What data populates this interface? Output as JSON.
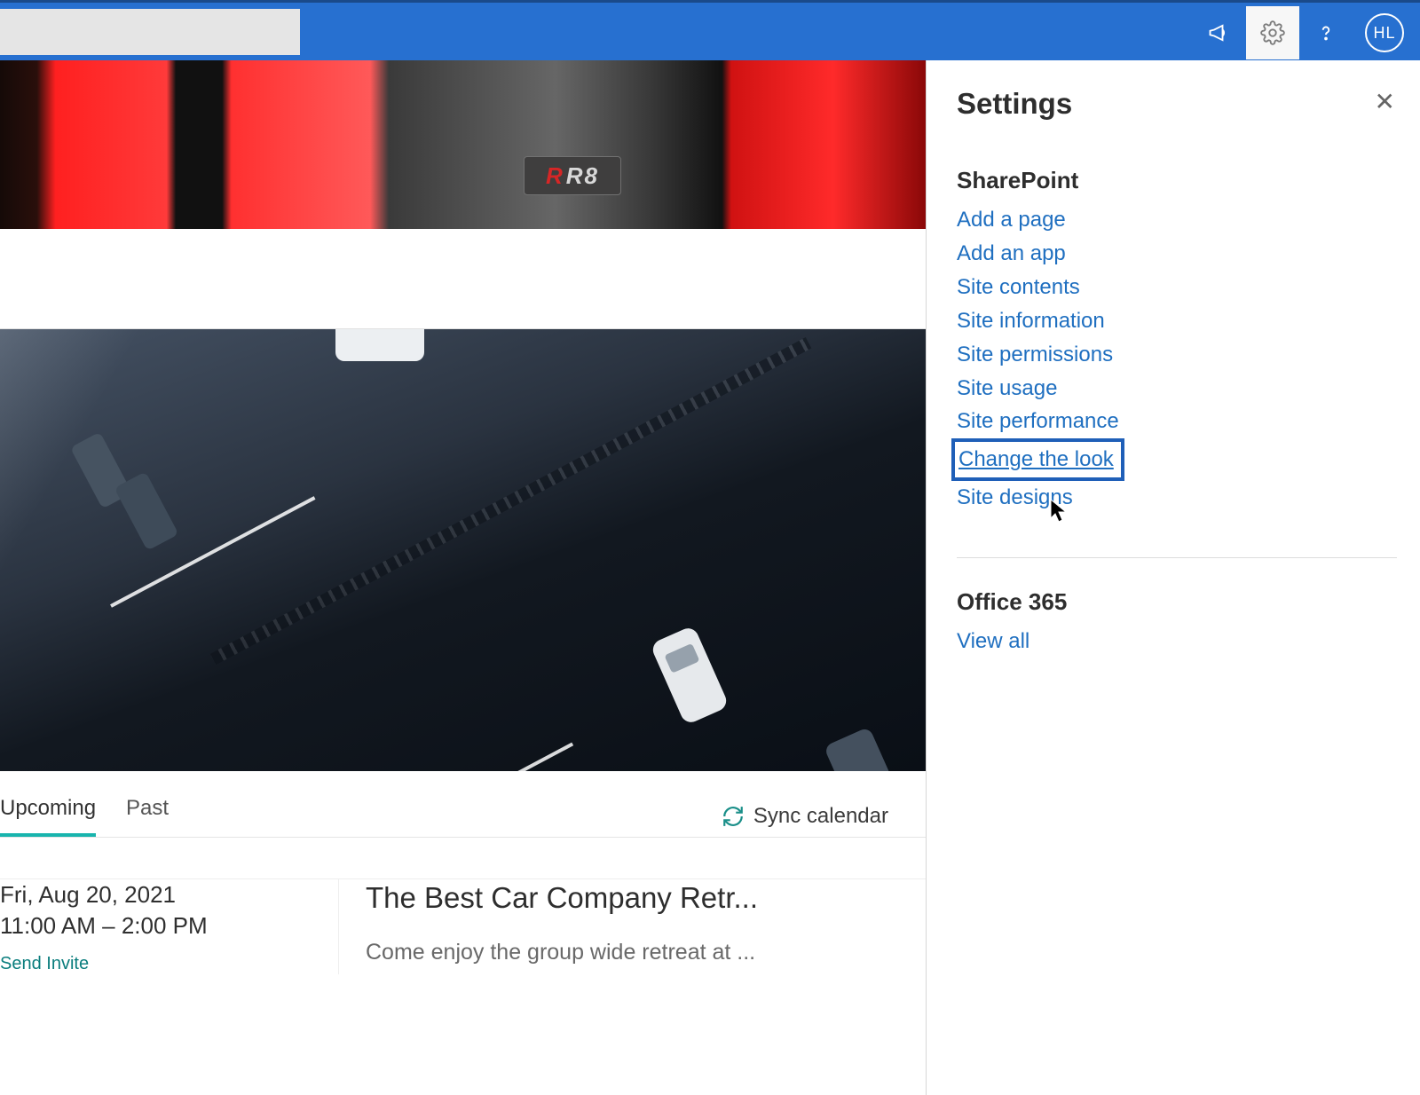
{
  "header": {
    "search_value": "",
    "avatar_initials": "HL"
  },
  "hero": {
    "badge_main": "R8"
  },
  "events": {
    "tab_upcoming": "Upcoming",
    "tab_past": "Past",
    "sync_label": "Sync calendar",
    "item1": {
      "date": "Fri, Aug 20, 2021",
      "time": "11:00 AM – 2:00 PM",
      "invite": "Send Invite",
      "title": "The Best Car Company Retr...",
      "desc": "Come enjoy the group wide retreat at ..."
    }
  },
  "settings": {
    "title": "Settings",
    "section1": "SharePoint",
    "links": {
      "add_page": "Add a page",
      "add_app": "Add an app",
      "contents": "Site contents",
      "info": "Site information",
      "perms": "Site permissions",
      "usage": "Site usage",
      "perf": "Site performance",
      "look": "Change the look",
      "designs": "Site designs"
    },
    "section2": "Office 365",
    "view_all": "View all"
  }
}
